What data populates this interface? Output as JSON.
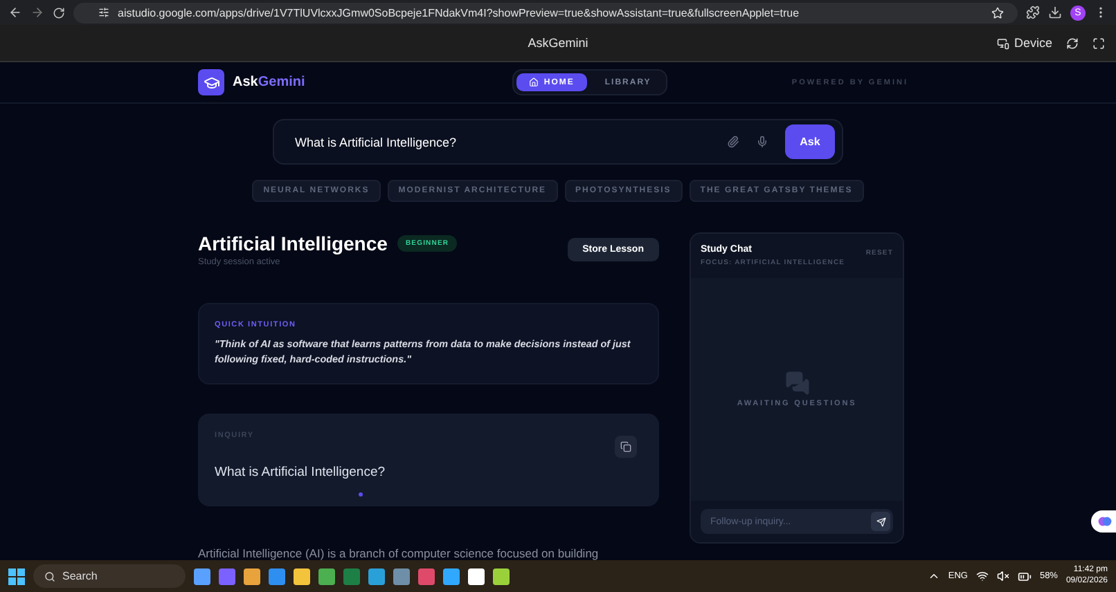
{
  "browser": {
    "url": "aistudio.google.com/apps/drive/1V7TlUVlcxxJGmw0SoBcpeje1FNdakVm4I?showPreview=true&showAssistant=true&fullscreenApplet=true",
    "profile": "S"
  },
  "studio_bar": {
    "title": "AskGemini",
    "device_label": "Device"
  },
  "app": {
    "logo_first": "Ask",
    "logo_second": "Gemini",
    "powered_by": "POWERED BY GEMINI",
    "nav": [
      {
        "label": "HOME",
        "selected": true
      },
      {
        "label": "LIBRARY",
        "selected": false
      }
    ],
    "search": {
      "value": "What is Artificial Intelligence?",
      "button": "Ask"
    },
    "topics": [
      "NEURAL NETWORKS",
      "MODERNIST ARCHITECTURE",
      "PHOTOSYNTHESIS",
      "THE GREAT GATSBY THEMES"
    ],
    "lesson": {
      "title": "Artificial Intelligence",
      "level_badge": "BEGINNER",
      "subtitle": "Study session active",
      "store_button": "Store Lesson",
      "intuition_label": "QUICK INTUITION",
      "intuition_text": "\"Think of AI as software that learns patterns from data to make decisions instead of just following fixed, hard-coded instructions.\"",
      "inquiry_label": "INQUIRY",
      "inquiry_text": "What is Artificial Intelligence?",
      "body": "Artificial Intelligence (AI) is a branch of computer science focused on building"
    },
    "chat": {
      "title": "Study Chat",
      "focus": "FOCUS: ARTIFICIAL INTELLIGENCE",
      "reset": "RESET",
      "empty": "AWAITING QUESTIONS",
      "placeholder": "Follow-up inquiry..."
    }
  },
  "taskbar": {
    "search": "Search",
    "language": "ENG",
    "battery": "58%",
    "time": "11:42 pm",
    "date": "09/02/2026"
  }
}
